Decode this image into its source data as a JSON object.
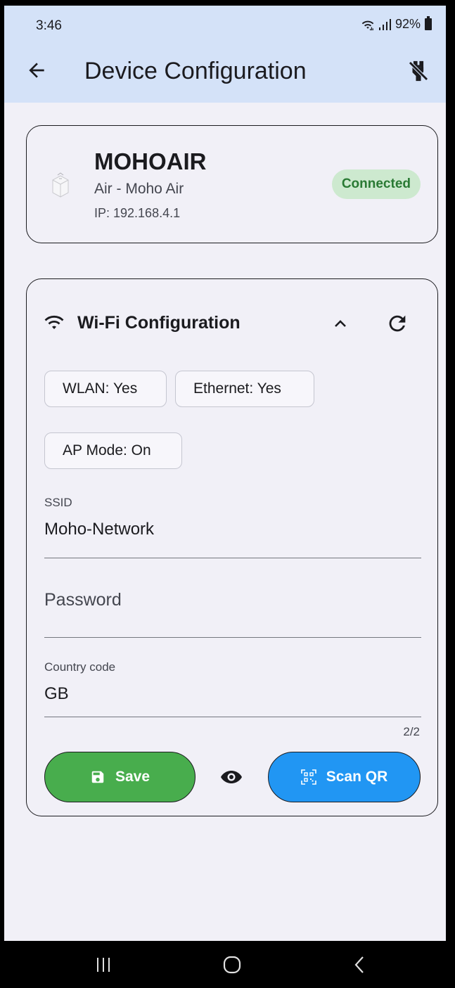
{
  "status_bar": {
    "time": "3:46",
    "battery": "92%"
  },
  "app_bar": {
    "title": "Device Configuration"
  },
  "device": {
    "name": "MOHOAIR",
    "model": "Air - Moho Air",
    "ip": "IP: 192.168.4.1",
    "status": "Connected"
  },
  "wifi": {
    "title": "Wi-Fi Configuration",
    "chips": {
      "wlan": "WLAN: Yes",
      "ethernet": "Ethernet: Yes",
      "ap_mode": "AP Mode: On"
    },
    "ssid": {
      "label": "SSID",
      "value": "Moho-Network"
    },
    "password": {
      "placeholder": "Password",
      "value": ""
    },
    "country": {
      "label": "Country code",
      "value": "GB",
      "counter": "2/2"
    },
    "buttons": {
      "save": "Save",
      "scan": "Scan QR"
    }
  },
  "colors": {
    "app_bar": "#d4e2f8",
    "background": "#f1f0f7",
    "save_button": "#48ad4d",
    "scan_button": "#2196f3",
    "connected_chip": "#cde9cf",
    "connected_text": "#2a7a34"
  }
}
